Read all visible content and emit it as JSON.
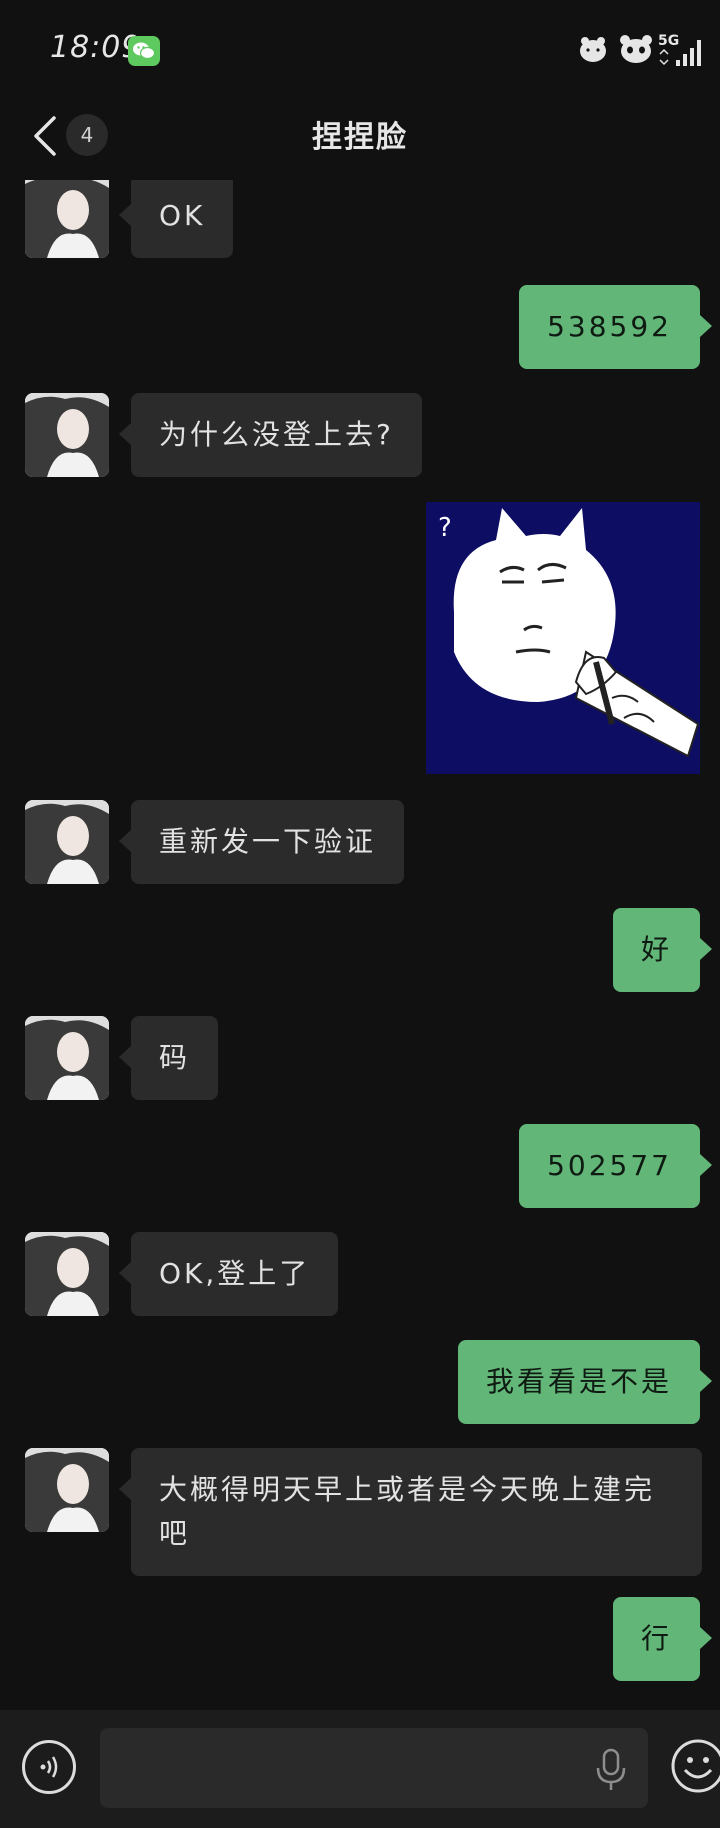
{
  "status": {
    "time": "18:09",
    "network": "5G"
  },
  "header": {
    "title": "捏捏脸",
    "unread": "4"
  },
  "messages": [
    {
      "side": "in",
      "text": "OK"
    },
    {
      "side": "out",
      "text": "538592"
    },
    {
      "side": "in",
      "text": "为什么没登上去?"
    },
    {
      "side": "out",
      "type": "sticker",
      "sticker_icon": "cat-pen-question-sticker"
    },
    {
      "side": "in",
      "text": "重新发一下验证"
    },
    {
      "side": "out",
      "text": "好"
    },
    {
      "side": "in",
      "text": "码"
    },
    {
      "side": "out",
      "text": "502577"
    },
    {
      "side": "in",
      "text": "OK,登上了"
    },
    {
      "side": "out",
      "text": "我看看是不是"
    },
    {
      "side": "in",
      "text": "大概得明天早上或者是今天晚上建完吧"
    },
    {
      "side": "out",
      "text": "行"
    }
  ],
  "composer": {
    "value": "",
    "placeholder": ""
  },
  "colors": {
    "background": "#111111",
    "incoming_bubble": "#2b2b2b",
    "outgoing_bubble": "#62b778",
    "sticker_bg": "#0d0d63"
  }
}
